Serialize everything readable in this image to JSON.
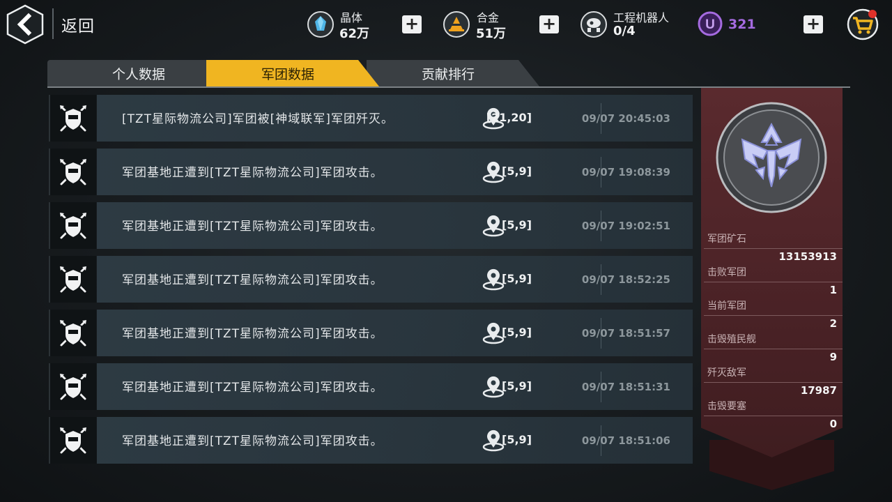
{
  "topbar": {
    "back_label": "返回",
    "resources": {
      "crystal": {
        "title": "晶体",
        "value": "62万",
        "color": "#4fb6e8"
      },
      "alloy": {
        "title": "合金",
        "value": "51万",
        "color": "#f0a21e"
      },
      "robot": {
        "title": "工程机器人",
        "value": "0/4"
      },
      "u_currency": {
        "symbol": "U",
        "value": "321",
        "color": "#a56be0"
      }
    },
    "plus_label": "+"
  },
  "tabs": [
    {
      "label": "个人数据",
      "active": false
    },
    {
      "label": "军团数据",
      "active": true
    },
    {
      "label": "贡献排行",
      "active": false
    }
  ],
  "log": [
    {
      "message": "[TZT星际物流公司]军团被[神域联军]军团歼灭。",
      "coord": "[21,20]",
      "time": "09/07 20:45:03"
    },
    {
      "message": "军团基地正遭到[TZT星际物流公司]军团攻击。",
      "coord": "[5,9]",
      "time": "09/07 19:08:39"
    },
    {
      "message": "军团基地正遭到[TZT星际物流公司]军团攻击。",
      "coord": "[5,9]",
      "time": "09/07 19:02:51"
    },
    {
      "message": "军团基地正遭到[TZT星际物流公司]军团攻击。",
      "coord": "[5,9]",
      "time": "09/07 18:52:25"
    },
    {
      "message": "军团基地正遭到[TZT星际物流公司]军团攻击。",
      "coord": "[5,9]",
      "time": "09/07 18:51:57"
    },
    {
      "message": "军团基地正遭到[TZT星际物流公司]军团攻击。",
      "coord": "[5,9]",
      "time": "09/07 18:51:31"
    },
    {
      "message": "军团基地正遭到[TZT星际物流公司]军团攻击。",
      "coord": "[5,9]",
      "time": "09/07 18:51:06"
    }
  ],
  "stats": [
    {
      "label": "军团矿石",
      "value": "13153913"
    },
    {
      "label": "击败军团",
      "value": "1"
    },
    {
      "label": "当前军团",
      "value": "2"
    },
    {
      "label": "击毁殖民舰",
      "value": "9"
    },
    {
      "label": "歼灭敌军",
      "value": "17987"
    },
    {
      "label": "击毁要塞",
      "value": "0"
    }
  ],
  "icons": {
    "back": "chevron-left-icon",
    "crystal": "crystal-icon",
    "alloy": "alloy-icon",
    "robot": "robot-icon",
    "currency": "u-currency-icon",
    "shop": "shopping-cart-icon",
    "row": "crossed-swords-shield-icon",
    "location": "map-pin-icon",
    "emblem": "legion-emblem-icon"
  },
  "colors": {
    "active_tab": "#f0b521",
    "panel": "#4a2226",
    "cart_badge": "#e0312a"
  }
}
